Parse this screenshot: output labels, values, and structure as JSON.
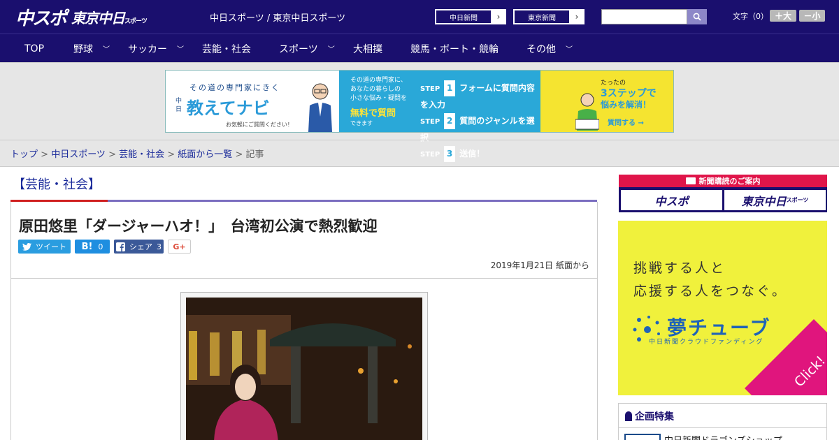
{
  "header": {
    "logo_chuspo": "中スポ",
    "logo_tokyo": "東京中日",
    "logo_tokyo_small": "スポーツ",
    "site_names": "中日スポーツ / 東京中日スポーツ",
    "btn_chunichi": "中日新聞",
    "btn_tokyo": "東京新聞",
    "search_placeholder": "",
    "moji_label": "文字（0）",
    "size_up": "＋大",
    "size_down": "－小"
  },
  "nav": {
    "items": [
      {
        "label": "TOP",
        "dropdown": false
      },
      {
        "label": "野球",
        "dropdown": true
      },
      {
        "label": "サッカー",
        "dropdown": true
      },
      {
        "label": "芸能・社会",
        "dropdown": false
      },
      {
        "label": "スポーツ",
        "dropdown": true
      },
      {
        "label": "大相撲",
        "dropdown": false
      },
      {
        "label": "競馬・ボート・競輪",
        "dropdown": false
      },
      {
        "label": "その他",
        "dropdown": true
      }
    ]
  },
  "ad": {
    "left_line1": "その道の専門家にきく",
    "left_brand": "教えてナビ",
    "left_vertical": "中日",
    "left_note": "お気軽にご質問ください！",
    "mid_line1": "その道の専門家に、",
    "mid_line2": "あなたの暮らしの",
    "mid_line3": "小さな悩み・疑問を",
    "mid_highlight": "無料で質問",
    "mid_line4": "できます",
    "step1": "フォームに質問内容を入力",
    "step2": "質問のジャンルを選択",
    "step3": "送信！",
    "step_label": "STEP",
    "step_nums": [
      "1",
      "2",
      "3"
    ],
    "right_line1": "たったの",
    "right_line2": "3ステップで",
    "right_line3": "悩みを解消！",
    "right_cta": "質問する →"
  },
  "breadcrumb": {
    "items": [
      "トップ",
      "中日スポーツ",
      "芸能・社会",
      "紙面から一覧"
    ],
    "current": "記事",
    "sep": " > "
  },
  "article": {
    "category": "【芸能・社会】",
    "title": "原田悠里「ダージャーハオ！」　台湾初公演で熱烈歓迎",
    "tweet_label": "ツイート",
    "hatena_label": "B!",
    "hatena_count": "0",
    "fb_label": "シェア",
    "fb_count": "3",
    "gplus_label": "G+",
    "date": "2019年1月21日 紙面から"
  },
  "sidebar": {
    "subscribe_head": "新聞購読のご案内",
    "subscribe_chuspo": "中スポ",
    "subscribe_tokyo": "東京中日",
    "subscribe_tokyo_small": "スポーツ",
    "yume_line1": "挑戦する人と",
    "yume_line2": "応援する人をつなぐ。",
    "yume_logo": "夢チューブ",
    "yume_sub": "中日新聞クラウドファンディング",
    "yume_click": "Click!",
    "kikaku_head": "企画特集",
    "kikaku_item": "中日新聞ドラゴンズショップ"
  },
  "colors": {
    "header_bg": "#1a0f6e",
    "accent_red": "#d02020",
    "accent_purple": "#7b6ec0",
    "link_blue": "#1a2a9a",
    "twitter": "#2a9de0",
    "hatena": "#1e8ee0",
    "facebook": "#3b5998"
  }
}
